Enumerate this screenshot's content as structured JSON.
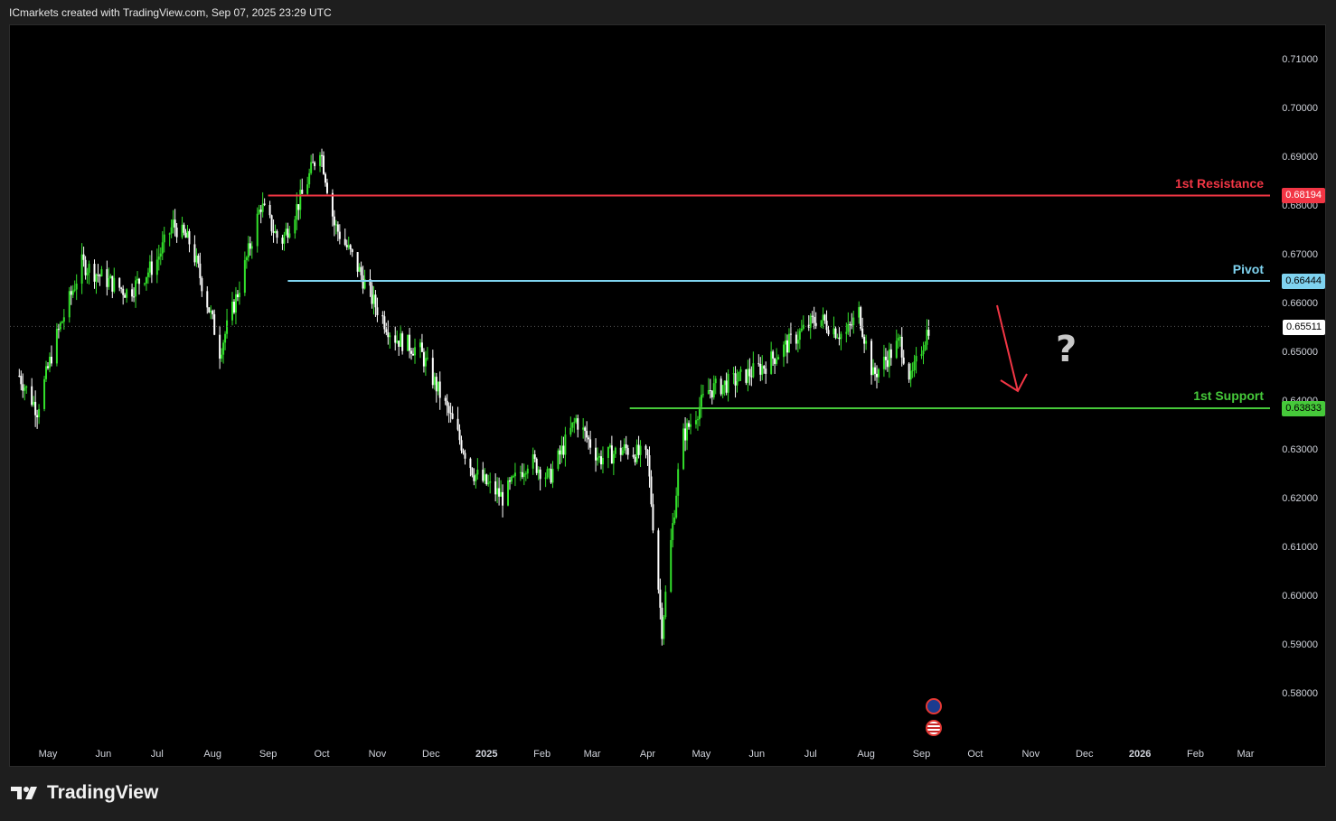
{
  "header": {
    "attribution": "ICmarkets created with TradingView.com, Sep 07, 2025 23:29 UTC"
  },
  "footer": {
    "brand": "TradingView"
  },
  "colors": {
    "background": "#000000",
    "up_candle": "#33e02b",
    "down_candle": "#ffffff",
    "resistance": "#f23645",
    "pivot": "#7fd3f0",
    "support": "#46c93a",
    "arrow": "#f23645"
  },
  "annotations": {
    "resistance_label": "1st Resistance",
    "resistance_value": "0.68194",
    "pivot_label": "Pivot",
    "pivot_value": "0.66444",
    "support_label": "1st Support",
    "support_value": "0.63833",
    "last_price": "0.65511",
    "question_mark": "?"
  },
  "chart_data": {
    "type": "candlestick",
    "title": "",
    "xlabel": "",
    "ylabel": "",
    "ylim": [
      0.575,
      0.715
    ],
    "y_ticks": [
      "0.71000",
      "0.70000",
      "0.69000",
      "0.68000",
      "0.67000",
      "0.66000",
      "0.65000",
      "0.64000",
      "0.63000",
      "0.62000",
      "0.61000",
      "0.60000",
      "0.59000",
      "0.58000"
    ],
    "x_ticks": [
      "May",
      "Jun",
      "Jul",
      "Aug",
      "Sep",
      "Oct",
      "Nov",
      "Dec",
      "2025",
      "Feb",
      "Mar",
      "Apr",
      "May",
      "Jun",
      "Jul",
      "Aug",
      "Sep",
      "Oct",
      "Nov",
      "Dec",
      "2026",
      "Feb",
      "Mar"
    ],
    "horizontal_levels": [
      {
        "name": "1st Resistance",
        "value": 0.68194
      },
      {
        "name": "Pivot",
        "value": 0.66444
      },
      {
        "name": "1st Support",
        "value": 0.63833
      }
    ],
    "last_price": 0.65511,
    "price_path": [
      [
        "2024-04-15",
        0.645
      ],
      [
        "2024-04-25",
        0.638
      ],
      [
        "2024-05-05",
        0.652
      ],
      [
        "2024-05-20",
        0.668
      ],
      [
        "2024-06-01",
        0.665
      ],
      [
        "2024-06-15",
        0.662
      ],
      [
        "2024-06-30",
        0.668
      ],
      [
        "2024-07-10",
        0.676
      ],
      [
        "2024-07-20",
        0.672
      ],
      [
        "2024-08-01",
        0.656
      ],
      [
        "2024-08-05",
        0.65
      ],
      [
        "2024-08-15",
        0.662
      ],
      [
        "2024-08-28",
        0.68
      ],
      [
        "2024-09-08",
        0.672
      ],
      [
        "2024-09-20",
        0.682
      ],
      [
        "2024-09-30",
        0.692
      ],
      [
        "2024-10-08",
        0.676
      ],
      [
        "2024-10-20",
        0.668
      ],
      [
        "2024-10-30",
        0.66
      ],
      [
        "2024-11-10",
        0.653
      ],
      [
        "2024-11-25",
        0.65
      ],
      [
        "2024-12-10",
        0.638
      ],
      [
        "2024-12-25",
        0.625
      ],
      [
        "2025-01-10",
        0.62
      ],
      [
        "2025-01-25",
        0.628
      ],
      [
        "2025-02-05",
        0.624
      ],
      [
        "2025-02-20",
        0.636
      ],
      [
        "2025-03-05",
        0.628
      ],
      [
        "2025-03-20",
        0.63
      ],
      [
        "2025-04-01",
        0.628
      ],
      [
        "2025-04-09",
        0.593
      ],
      [
        "2025-04-20",
        0.632
      ],
      [
        "2025-05-05",
        0.642
      ],
      [
        "2025-05-20",
        0.644
      ],
      [
        "2025-06-05",
        0.647
      ],
      [
        "2025-06-20",
        0.652
      ],
      [
        "2025-07-05",
        0.657
      ],
      [
        "2025-07-20",
        0.653
      ],
      [
        "2025-07-28",
        0.658
      ],
      [
        "2025-08-05",
        0.645
      ],
      [
        "2025-08-20",
        0.652
      ],
      [
        "2025-08-26",
        0.644
      ],
      [
        "2025-09-05",
        0.6551
      ]
    ]
  }
}
